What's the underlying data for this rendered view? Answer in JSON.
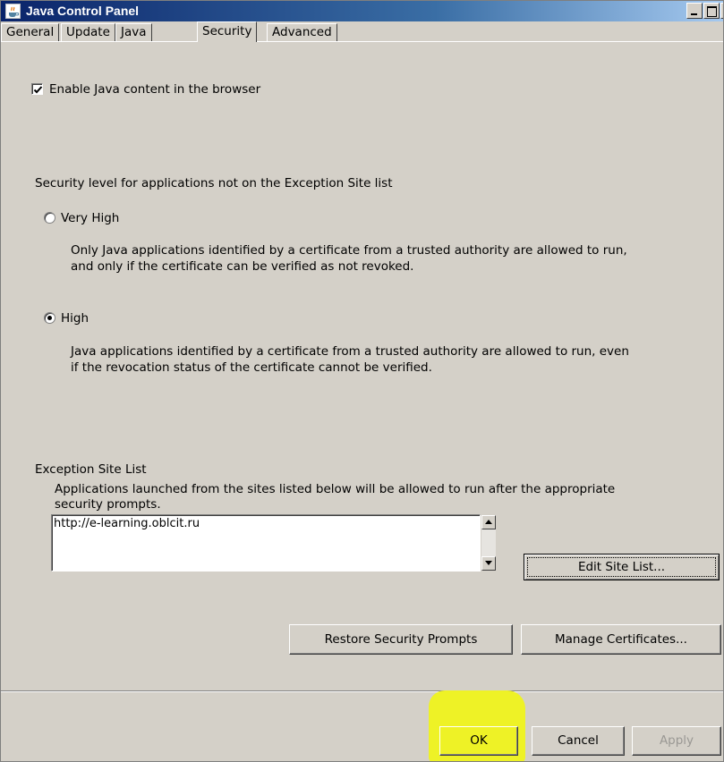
{
  "window": {
    "title": "Java Control Panel"
  },
  "tabs": [
    {
      "label": "General"
    },
    {
      "label": "Update"
    },
    {
      "label": "Java"
    },
    {
      "label": "Security"
    },
    {
      "label": "Advanced"
    }
  ],
  "security": {
    "enable_java_label": "Enable Java content in the browser",
    "enable_java_checked": true,
    "level_heading": "Security level for applications not on the Exception Site list",
    "levels": [
      {
        "label": "Very High",
        "description_line1": "Only Java applications identified by a certificate from a trusted authority are allowed to run,",
        "description_line2": "and only if the certificate can be verified as not revoked.",
        "selected": false
      },
      {
        "label": "High",
        "description_line1": "Java applications identified by a certificate from a trusted authority are allowed to run, even",
        "description_line2": "if the revocation status of the certificate cannot be verified.",
        "selected": true
      }
    ],
    "exception": {
      "heading": "Exception Site List",
      "description_line1": "Applications launched from the sites listed below will be allowed to run after the appropriate",
      "description_line2": "security prompts.",
      "sites": [
        "http://e-learning.oblcit.ru"
      ],
      "edit_button": "Edit Site List..."
    },
    "restore_button": "Restore Security Prompts",
    "manage_button": "Manage Certificates..."
  },
  "footer": {
    "ok": "OK",
    "cancel": "Cancel",
    "apply": "Apply",
    "highlight_color": "#eef226"
  }
}
